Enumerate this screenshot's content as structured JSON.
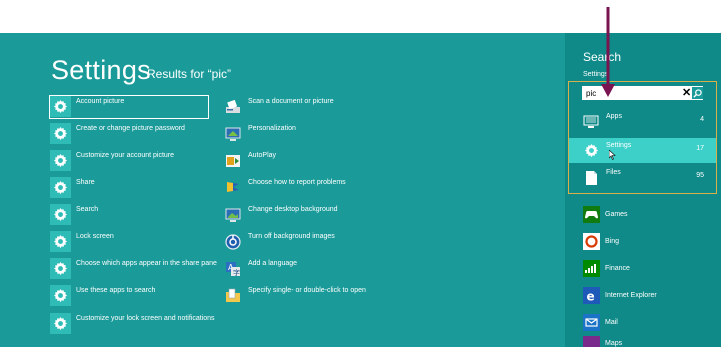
{
  "page": {
    "title": "Settings",
    "results_for": "Results for “pic”"
  },
  "results_left": [
    {
      "label": "Account picture"
    },
    {
      "label": "Create or change picture password"
    },
    {
      "label": "Customize your account picture"
    },
    {
      "label": "Share"
    },
    {
      "label": "Search"
    },
    {
      "label": "Lock screen"
    },
    {
      "label": "Choose which apps appear in the share pane"
    },
    {
      "label": "Use these apps to search"
    },
    {
      "label": "Customize your lock screen and notifications"
    }
  ],
  "results_right": [
    {
      "label": "Scan a document or picture",
      "icon": "scanner-icon"
    },
    {
      "label": "Personalization",
      "icon": "personalization-icon"
    },
    {
      "label": "AutoPlay",
      "icon": "autoplay-icon"
    },
    {
      "label": "Choose how to report problems",
      "icon": "flag-icon"
    },
    {
      "label": "Change desktop background",
      "icon": "desktop-background-icon"
    },
    {
      "label": "Turn off background images",
      "icon": "ease-of-access-icon"
    },
    {
      "label": "Add a language",
      "icon": "language-icon"
    },
    {
      "label": "Specify single- or double-click to open",
      "icon": "folder-options-icon"
    }
  ],
  "charm": {
    "title": "Search",
    "subtitle": "Settings",
    "query": "pic",
    "scopes": [
      {
        "label": "Apps",
        "count": "4"
      },
      {
        "label": "Settings",
        "count": "17"
      },
      {
        "label": "Files",
        "count": "95"
      }
    ],
    "apps": [
      {
        "label": "Games",
        "color": "#107c10"
      },
      {
        "label": "Bing",
        "color": "#e8e8e8"
      },
      {
        "label": "Finance",
        "color": "#008a00"
      },
      {
        "label": "Internet Explorer",
        "color": "#1e5bb8"
      },
      {
        "label": "Mail",
        "color": "#1a73c7"
      },
      {
        "label": "Maps",
        "color": "#7a2a8a"
      }
    ]
  },
  "colors": {
    "results_bg": "#1a9b99",
    "charm_bg": "#0f8a88",
    "active_scope": "#3dd0c9",
    "highlight_border": "#d8b04a",
    "arrow": "#7a1450"
  }
}
